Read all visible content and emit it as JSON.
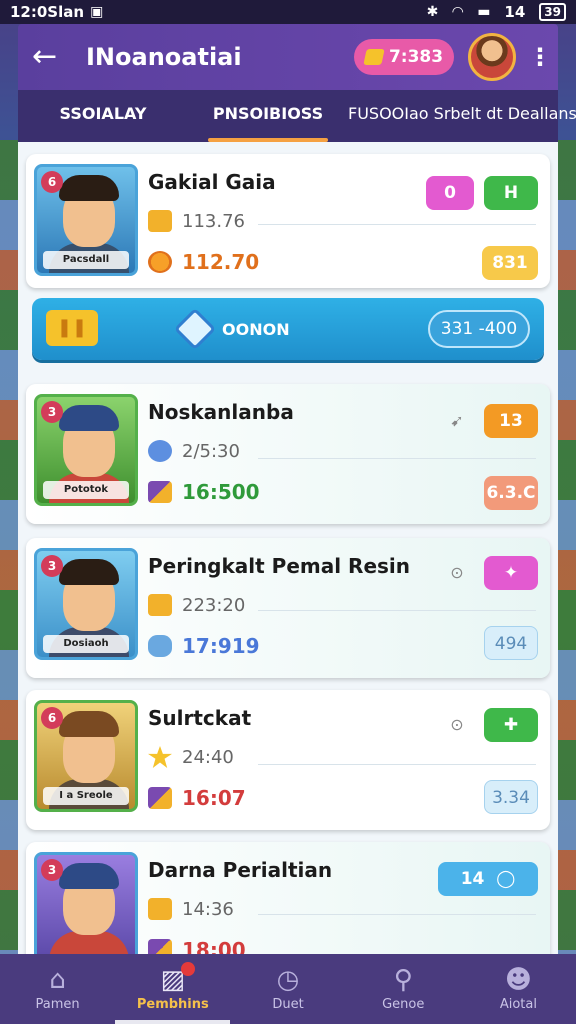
{
  "status_bar": {
    "time": "12:0Slan",
    "battery": "14",
    "battery_icon": "battery-icon",
    "wifi_icon": "wifi-icon",
    "bluetooth_icon": "bluetooth-icon"
  },
  "header": {
    "title": "INoanoatiai",
    "coins": "7:383",
    "back_icon": "back-arrow-icon",
    "more_icon": "more-vertical-icon"
  },
  "tabs": [
    {
      "label": "SSOIALAY",
      "active": false
    },
    {
      "label": "PNSOIBIOSS",
      "active": true
    },
    {
      "label": "FUSOOIao Srbelt dt Deallans",
      "active": false
    }
  ],
  "cards": [
    {
      "name": "Gakial Gaia",
      "plate": "Pacsdall",
      "rank": "6",
      "stat1": "113.76",
      "stat2": "112.70",
      "stat2_color": "#e0701c",
      "pill_top_a": "0",
      "pill_top_b": "H",
      "pill_bottom": "831"
    },
    {
      "name": "Noskanlanba",
      "plate": "Pototok",
      "rank": "3",
      "stat1": "2/5:30",
      "stat2": "16:500",
      "stat2_color": "#2f9a3a",
      "pill_top": "13",
      "pill_bottom": "6.3.C"
    },
    {
      "name": "Peringkalt Pemal Resin",
      "plate": "Dosiaoh",
      "rank": "3",
      "stat1": "223:20",
      "stat2": "17:919",
      "stat2_color": "#4a78d8",
      "pill_bottom": "494"
    },
    {
      "name": "Sulrtckat",
      "plate": "I a Sreole",
      "rank": "6",
      "stat1": "24:40",
      "stat2": "16:07",
      "stat2_color": "#d33c3c",
      "pill_bottom": "3.34"
    },
    {
      "name": "Darna Perialtian",
      "rank": "3",
      "stat1": "14:36",
      "stat2": "18:00",
      "stat2_color": "#d33c3c",
      "pill_top": "14"
    }
  ],
  "banner": {
    "label": "OONON",
    "value": "331 -400",
    "left_icon": "ticket-icon",
    "gem_icon": "gem-icon"
  },
  "bottom_nav": [
    {
      "label": "Pamen",
      "icon": "home-icon",
      "active": false
    },
    {
      "label": "Pembhins",
      "icon": "image-icon",
      "active": true
    },
    {
      "label": "Duet",
      "icon": "clock-icon",
      "active": false
    },
    {
      "label": "Genoe",
      "icon": "search-icon",
      "active": false
    },
    {
      "label": "Aiotal",
      "icon": "profile-icon",
      "active": false
    }
  ]
}
